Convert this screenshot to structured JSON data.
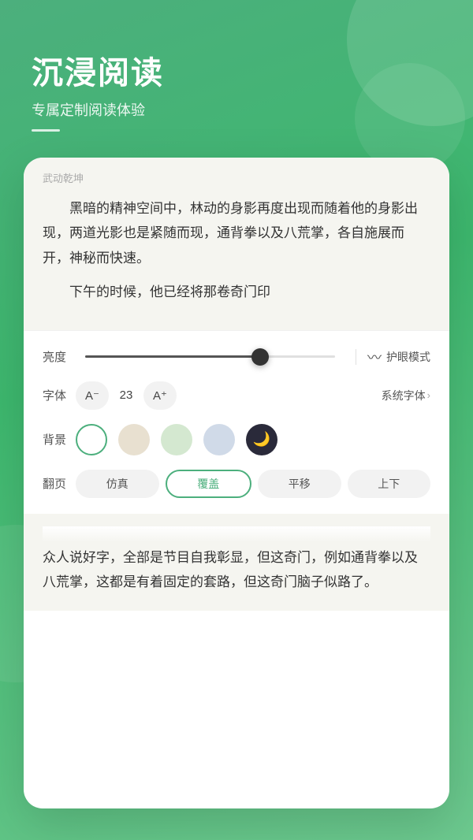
{
  "header": {
    "title": "沉浸阅读",
    "subtitle": "专属定制阅读体验"
  },
  "book": {
    "title": "武动乾坤",
    "text_para1": "黑暗的精神空间中，林动的身影再度出现而随着他的身影出现，两道光影也是紧随而现，通背拳以及八荒掌，各自施展而开，神秘而快速。",
    "text_para2": "下午的时候，他已经将那卷奇门印",
    "bottom_text1": "众人说好字，全部是节目自我彰显，但这奇门，例如通背拳以及八荒掌，这都是有着固定的套路，但这奇门脑子似路了。"
  },
  "settings": {
    "brightness_label": "亮度",
    "brightness_value": 70,
    "eye_mode_label": "护眼模式",
    "font_label": "字体",
    "font_decrease": "A⁻",
    "font_size": "23",
    "font_increase": "A⁺",
    "font_family": "系统字体",
    "font_family_arrow": "›",
    "bg_label": "背景",
    "bg_options": [
      "white",
      "beige",
      "green",
      "blue",
      "dark"
    ],
    "bg_selected": "white",
    "pageturn_label": "翻页",
    "pageturn_options": [
      "仿真",
      "覆盖",
      "平移",
      "上下"
    ],
    "pageturn_selected": "覆盖"
  }
}
